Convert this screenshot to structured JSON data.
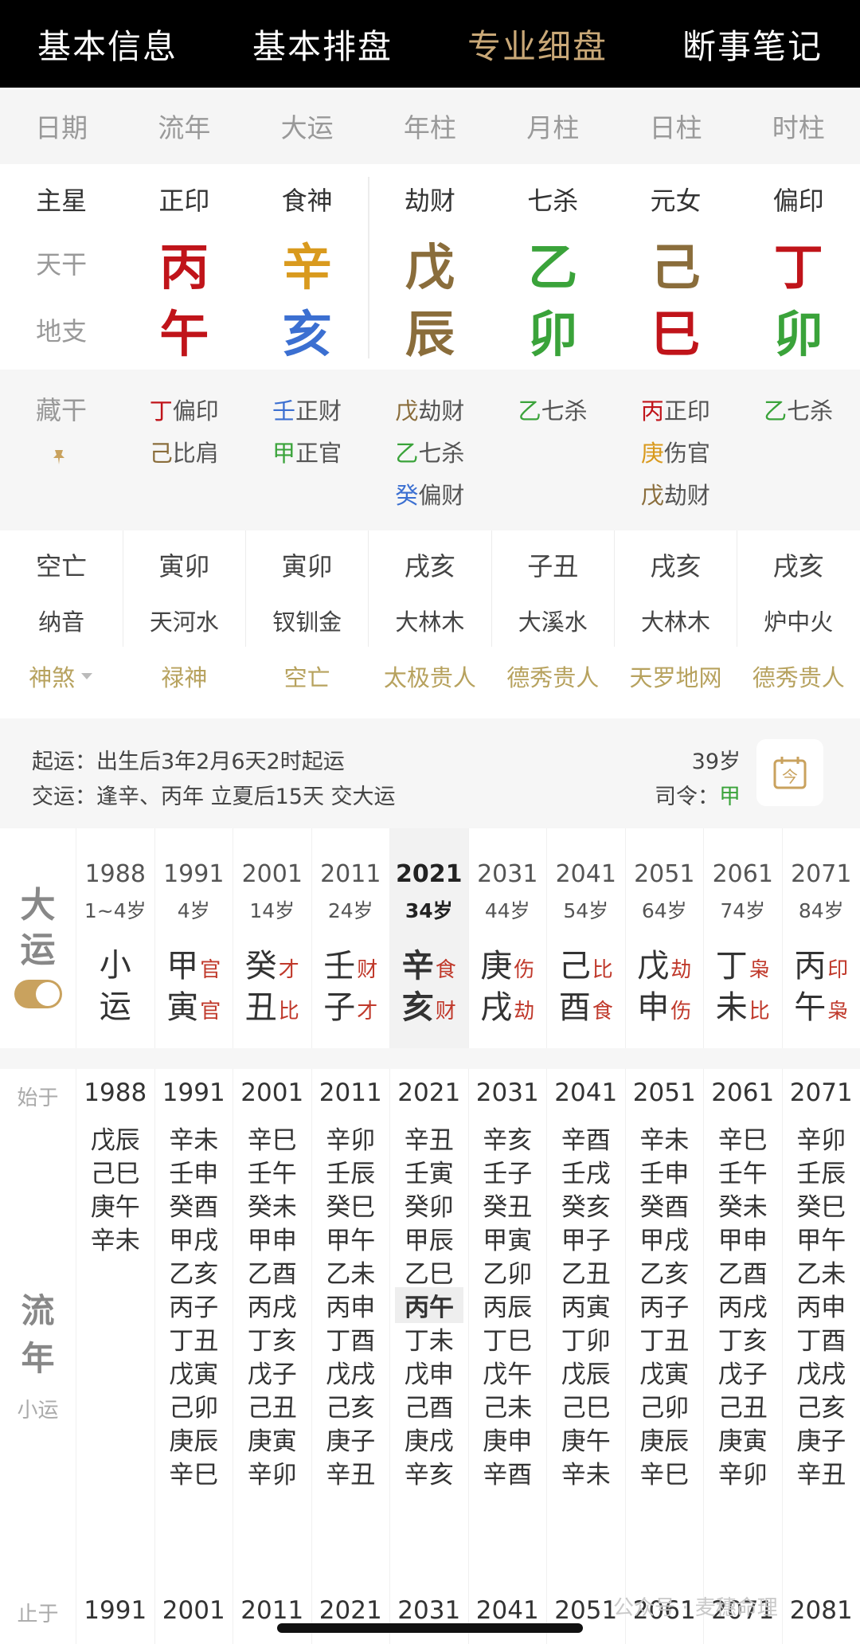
{
  "nav": {
    "tabs": [
      {
        "label": "基本信息",
        "active": false
      },
      {
        "label": "基本排盘",
        "active": false
      },
      {
        "label": "专业细盘",
        "active": true
      },
      {
        "label": "断事笔记",
        "active": false
      }
    ]
  },
  "header": {
    "labels": [
      "日期",
      "流年",
      "大运",
      "年柱",
      "月柱",
      "日柱",
      "时柱"
    ]
  },
  "pillars": {
    "row_labels": {
      "star": "主星",
      "gan": "天干",
      "zhi": "地支"
    },
    "columns": [
      {
        "star": "正印",
        "gan": "丙",
        "gan_color": "#c0141a",
        "zhi": "午",
        "zhi_color": "#c0141a"
      },
      {
        "star": "食神",
        "gan": "辛",
        "gan_color": "#d99a1e",
        "zhi": "亥",
        "zhi_color": "#3b6fd1"
      },
      {
        "star": "劫财",
        "gan": "戊",
        "gan_color": "#8a6d3b",
        "zhi": "辰",
        "zhi_color": "#8a6d3b"
      },
      {
        "star": "七杀",
        "gan": "乙",
        "gan_color": "#3aa33a",
        "zhi": "卯",
        "zhi_color": "#3aa33a"
      },
      {
        "star": "元女",
        "gan": "己",
        "gan_color": "#8a6d3b",
        "zhi": "巳",
        "zhi_color": "#c0141a"
      },
      {
        "star": "偏印",
        "gan": "丁",
        "gan_color": "#c0141a",
        "zhi": "卯",
        "zhi_color": "#3aa33a"
      }
    ]
  },
  "hidden_stems": {
    "label": "藏干",
    "columns": [
      [
        {
          "gan": "丁",
          "color": "#c0141a",
          "god": "偏印"
        },
        {
          "gan": "己",
          "color": "#8a6d3b",
          "god": "比肩"
        }
      ],
      [
        {
          "gan": "壬",
          "color": "#3b6fd1",
          "god": "正财"
        },
        {
          "gan": "甲",
          "color": "#3aa33a",
          "god": "正官"
        }
      ],
      [
        {
          "gan": "戊",
          "color": "#8a6d3b",
          "god": "劫财"
        },
        {
          "gan": "乙",
          "color": "#3aa33a",
          "god": "七杀"
        },
        {
          "gan": "癸",
          "color": "#3b6fd1",
          "god": "偏财"
        }
      ],
      [
        {
          "gan": "乙",
          "color": "#3aa33a",
          "god": "七杀"
        }
      ],
      [
        {
          "gan": "丙",
          "color": "#c0141a",
          "god": "正印"
        },
        {
          "gan": "庚",
          "color": "#d99a1e",
          "god": "伤官"
        },
        {
          "gan": "戊",
          "color": "#8a6d3b",
          "god": "劫财"
        }
      ],
      [
        {
          "gan": "乙",
          "color": "#3aa33a",
          "god": "七杀"
        }
      ]
    ]
  },
  "kongwang": {
    "label": "空亡",
    "values": [
      "寅卯",
      "寅卯",
      "戌亥",
      "子丑",
      "戌亥",
      "戌亥"
    ]
  },
  "nayin": {
    "label": "纳音",
    "values": [
      "天河水",
      "钗钏金",
      "大林木",
      "大溪水",
      "大林木",
      "炉中火"
    ]
  },
  "shensha": {
    "label": "神煞",
    "values": [
      "禄神",
      "空亡",
      "太极贵人",
      "德秀贵人",
      "天罗地网",
      "德秀贵人"
    ]
  },
  "qiyun": {
    "line1": "起运：出生后3年2月6天2时起运",
    "line2": "交运：逢辛、丙年 立夏后15天 交大运",
    "age": "39岁",
    "siling_label": "司令：",
    "siling_value": "甲",
    "calendar_icon_text": "今"
  },
  "dayun": {
    "label": [
      "大",
      "运"
    ],
    "xiaoyun": {
      "year": "1988",
      "age": "1~4岁",
      "text": [
        "小",
        "运"
      ]
    },
    "columns": [
      {
        "year": "1991",
        "age": "4岁",
        "gan": "甲",
        "gan_ss": "官",
        "zhi": "寅",
        "zhi_ss": "官",
        "current": false
      },
      {
        "year": "2001",
        "age": "14岁",
        "gan": "癸",
        "gan_ss": "才",
        "zhi": "丑",
        "zhi_ss": "比",
        "current": false
      },
      {
        "year": "2011",
        "age": "24岁",
        "gan": "壬",
        "gan_ss": "财",
        "zhi": "子",
        "zhi_ss": "才",
        "current": false
      },
      {
        "year": "2021",
        "age": "34岁",
        "gan": "辛",
        "gan_ss": "食",
        "zhi": "亥",
        "zhi_ss": "财",
        "current": true
      },
      {
        "year": "2031",
        "age": "44岁",
        "gan": "庚",
        "gan_ss": "伤",
        "zhi": "戌",
        "zhi_ss": "劫",
        "current": false
      },
      {
        "year": "2041",
        "age": "54岁",
        "gan": "己",
        "gan_ss": "比",
        "zhi": "酉",
        "zhi_ss": "食",
        "current": false
      },
      {
        "year": "2051",
        "age": "64岁",
        "gan": "戊",
        "gan_ss": "劫",
        "zhi": "申",
        "zhi_ss": "伤",
        "current": false
      },
      {
        "year": "2061",
        "age": "74岁",
        "gan": "丁",
        "gan_ss": "枭",
        "zhi": "未",
        "zhi_ss": "比",
        "current": false
      },
      {
        "year": "2071",
        "age": "84岁",
        "gan": "丙",
        "gan_ss": "印",
        "zhi": "午",
        "zhi_ss": "枭",
        "current": false
      }
    ]
  },
  "liunian": {
    "start_label": "始于",
    "end_label": "止于",
    "label": [
      "流",
      "年"
    ],
    "sub_label": "小运",
    "columns": [
      {
        "start": "1988",
        "items": [
          "戊辰",
          "己巳",
          "庚午",
          "辛未"
        ],
        "end": "1991"
      },
      {
        "start": "1991",
        "items": [
          "辛未",
          "壬申",
          "癸酉",
          "甲戌",
          "乙亥",
          "丙子",
          "丁丑",
          "戊寅",
          "己卯",
          "庚辰",
          "辛巳"
        ],
        "end": "2001"
      },
      {
        "start": "2001",
        "items": [
          "辛巳",
          "壬午",
          "癸未",
          "甲申",
          "乙酉",
          "丙戌",
          "丁亥",
          "戊子",
          "己丑",
          "庚寅",
          "辛卯"
        ],
        "end": "2011"
      },
      {
        "start": "2011",
        "items": [
          "辛卯",
          "壬辰",
          "癸巳",
          "甲午",
          "乙未",
          "丙申",
          "丁酉",
          "戊戌",
          "己亥",
          "庚子",
          "辛丑"
        ],
        "end": "2021"
      },
      {
        "start": "2021",
        "items": [
          "辛丑",
          "壬寅",
          "癸卯",
          "甲辰",
          "乙巳",
          "丙午",
          "丁未",
          "戊申",
          "己酉",
          "庚戌",
          "辛亥"
        ],
        "end": "2031",
        "highlight_index": 5
      },
      {
        "start": "2031",
        "items": [
          "辛亥",
          "壬子",
          "癸丑",
          "甲寅",
          "乙卯",
          "丙辰",
          "丁巳",
          "戊午",
          "己未",
          "庚申",
          "辛酉"
        ],
        "end": "2041"
      },
      {
        "start": "2041",
        "items": [
          "辛酉",
          "壬戌",
          "癸亥",
          "甲子",
          "乙丑",
          "丙寅",
          "丁卯",
          "戊辰",
          "己巳",
          "庚午",
          "辛未"
        ],
        "end": "2051"
      },
      {
        "start": "2051",
        "items": [
          "辛未",
          "壬申",
          "癸酉",
          "甲戌",
          "乙亥",
          "丙子",
          "丁丑",
          "戊寅",
          "己卯",
          "庚辰",
          "辛巳"
        ],
        "end": "2061"
      },
      {
        "start": "2061",
        "items": [
          "辛巳",
          "壬午",
          "癸未",
          "甲申",
          "乙酉",
          "丙戌",
          "丁亥",
          "戊子",
          "己丑",
          "庚寅",
          "辛卯"
        ],
        "end": "2071"
      },
      {
        "start": "2071",
        "items": [
          "辛卯",
          "壬辰",
          "癸巳",
          "甲午",
          "乙未",
          "丙申",
          "丁酉",
          "戊戌",
          "己亥",
          "庚子",
          "辛丑"
        ],
        "end": "2081"
      }
    ]
  },
  "watermark": "公众号 · 麦穗命理",
  "colors": {
    "accent_gold": "#c9a877",
    "shensha_gold": "#b7a25e",
    "shishen_red": "#c0392b"
  }
}
